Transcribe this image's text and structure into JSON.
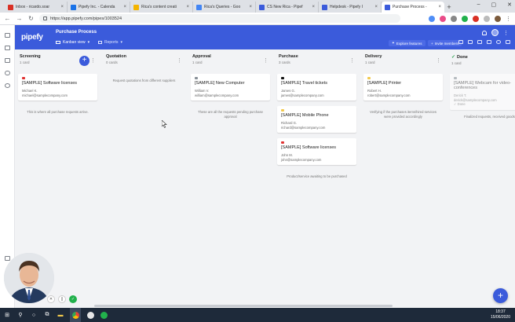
{
  "browser": {
    "tabs": [
      {
        "title": "Inbox - ricardo.soar",
        "color": "#d93025",
        "active": false
      },
      {
        "title": "Pipefy Inc. - Calenda",
        "color": "#1a73e8",
        "active": false
      },
      {
        "title": "Rica's content creati",
        "color": "#f4b400",
        "active": false
      },
      {
        "title": "Rica's Queries - Goo",
        "color": "#4285f4",
        "active": false
      },
      {
        "title": "CS New Rica - Pipef",
        "color": "#3b5bdb",
        "active": false
      },
      {
        "title": "Helpdesk - Pipefy I",
        "color": "#3b5bdb",
        "active": false
      },
      {
        "title": "Purchase Process -",
        "color": "#3b5bdb",
        "active": true
      }
    ],
    "url": "https://app.pipefy.com/pipes/1003524",
    "window_controls": [
      "–",
      "▢",
      "✕"
    ]
  },
  "header": {
    "logo": "pipefy",
    "pipe_title": "Purchase Process",
    "view_label": "Kanban view",
    "reports_label": "Reports",
    "explore_label": "Explore features",
    "invite_label": "Invite members"
  },
  "phases": [
    {
      "name": "Screening",
      "count": "1 card",
      "cards": [
        {
          "title": "[SAMPLE] Software licenses",
          "tag": "#e03131",
          "meta": [
            "Michael K.",
            "michael@samplecompany.com"
          ]
        }
      ],
      "note": "This is where all purchase requests arrive."
    },
    {
      "name": "Quotation",
      "count": "0 cards",
      "cards": [],
      "note": "Request quotations from different suppliers"
    },
    {
      "name": "Approval",
      "count": "1 card",
      "cards": [
        {
          "title": "[SAMPLE] New Computer",
          "tag": "#868e96",
          "meta": [
            "William V.",
            "william@samplecompany.com"
          ]
        }
      ],
      "note": "These are all the requests pending purchase approval"
    },
    {
      "name": "Purchase",
      "count": "3 cards",
      "cards": [
        {
          "title": "[SAMPLE] Travel tickets",
          "tag": "#111111",
          "meta": [
            "James G.",
            "james@samplecompany.com"
          ]
        },
        {
          "title": "[SAMPLE] Mobile Phone",
          "tag": "#f2c94c",
          "meta": [
            "Richard G.",
            "richard@samplecompany.com"
          ]
        },
        {
          "title": "[SAMPLE] Software licenses",
          "tag": "#e03131",
          "meta": [
            "John M.",
            "john@samplecompany.com"
          ]
        }
      ],
      "note": "Product/service awaiting to be purchased"
    },
    {
      "name": "Delivery",
      "count": "1 card",
      "cards": [
        {
          "title": "[SAMPLE] Printer",
          "tag": "#f2c94c",
          "meta": [
            "Robert H.",
            "robert@samplecompany.com"
          ]
        }
      ],
      "note": "Verifying if the purchases items/hired services were provided accordingly"
    },
    {
      "name": "Done",
      "count": "1 card",
      "cards": [
        {
          "title": "[SAMPLE] Webcam for video-conferences",
          "tag": "#868e96",
          "meta": [
            "Derick T.",
            "derick@samplecompany.com",
            "✓ Done"
          ]
        }
      ],
      "note": "Finalized requests, received goods"
    }
  ],
  "taskbar": {
    "time": "18:37",
    "date": "15/06/2020"
  }
}
